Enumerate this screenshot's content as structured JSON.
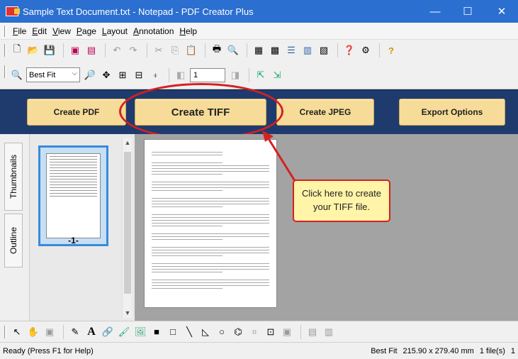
{
  "window": {
    "title": "Sample Text Document.txt - Notepad - PDF Creator Plus",
    "minimize": "—",
    "maximize": "☐",
    "close": "✕"
  },
  "menu": [
    "File",
    "Edit",
    "View",
    "Page",
    "Layout",
    "Annotation",
    "Help"
  ],
  "toolbar": {
    "zoom_value": "Best Fit",
    "page_value": "1"
  },
  "actions": {
    "create_pdf": "Create PDF",
    "create_tiff": "Create TIFF",
    "create_jpeg": "Create JPEG",
    "export_options": "Export Options"
  },
  "side_tabs": {
    "thumbnails": "Thumbnails",
    "outline": "Outline"
  },
  "thumbnail": {
    "label": "-1-"
  },
  "callout": {
    "text": "Click here to create your TIFF file."
  },
  "status": {
    "left": "Ready (Press F1 for Help)",
    "zoom": "Best Fit",
    "page_size": "215.90 x 279.40 mm",
    "file_count": "1 file(s)",
    "page_number": "1"
  },
  "colors": {
    "titlebar": "#2b6fd0",
    "action_band": "#1f3b6d",
    "action_button": "#f6dc98",
    "highlight": "#d62020",
    "callout_fill": "#fff4a8"
  }
}
